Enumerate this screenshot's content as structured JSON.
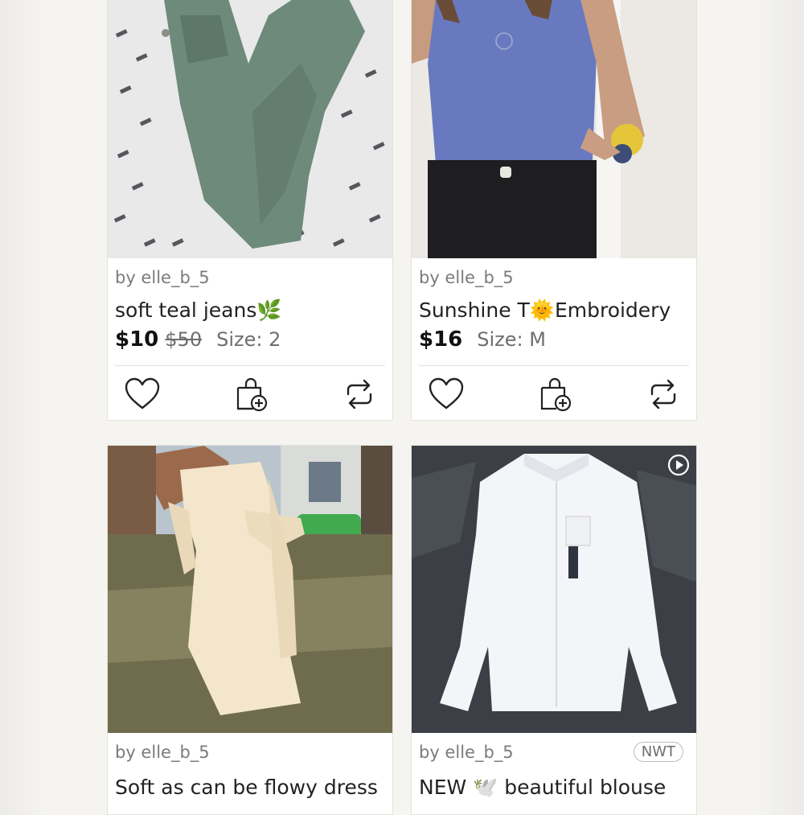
{
  "listings": [
    {
      "seller": "by elle_b_5",
      "title": "soft teal jeans🌿",
      "price": "$10",
      "original_price": "$50",
      "size": "Size: 2",
      "image_icon": "green-jeans-photo"
    },
    {
      "seller": "by elle_b_5",
      "title": "Sunshine T🌞Embroidery",
      "price": "$16",
      "original_price": "",
      "size": "Size: M",
      "image_icon": "blue-tshirt-photo"
    },
    {
      "seller": "by elle_b_5",
      "title": "Soft as can be flowy dress",
      "image_icon": "cream-dress-photo"
    },
    {
      "seller": "by elle_b_5",
      "title": "NEW 🕊️ beautiful blouse",
      "badge": "NWT",
      "image_icon": "white-blouse-photo",
      "has_video": true
    }
  ],
  "actions": {
    "like_icon": "heart-icon",
    "bundle_icon": "shopping-bag-plus-icon",
    "share_icon": "repost-icon"
  },
  "colors": {
    "background": "#f5f4f1",
    "card": "#ffffff",
    "text": "#222222",
    "muted": "#7b7b7b"
  }
}
